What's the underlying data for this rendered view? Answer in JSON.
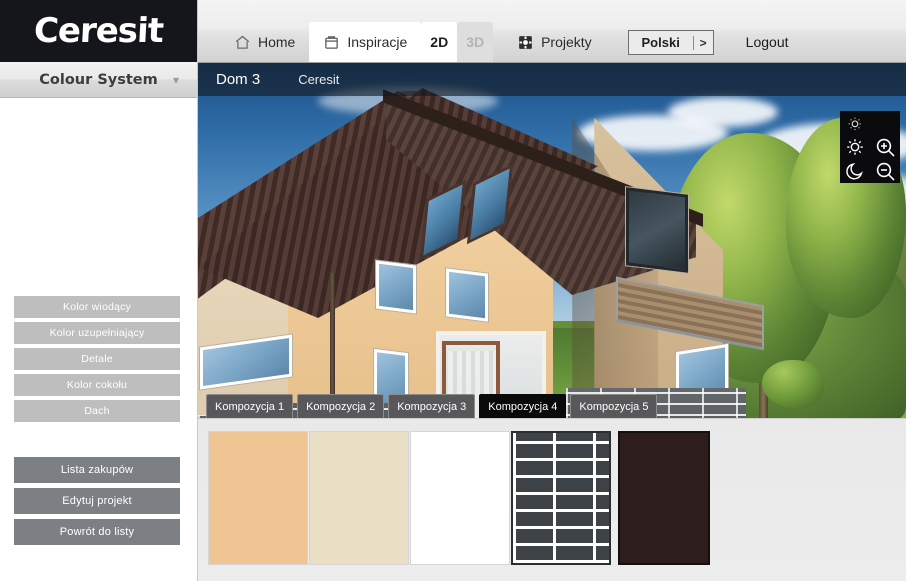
{
  "brand": {
    "name": "Ceresit"
  },
  "sidebar": {
    "header": {
      "title": "Colour System",
      "chevron": "chevron-down"
    },
    "color_buttons": [
      {
        "label": "Kolor wiodący"
      },
      {
        "label": "Kolor uzupełniający"
      },
      {
        "label": "Detale"
      },
      {
        "label": "Kolor cokołu"
      },
      {
        "label": "Dach"
      }
    ],
    "action_buttons": [
      {
        "label": "Lista zakupów"
      },
      {
        "label": "Edytuj projekt"
      },
      {
        "label": "Powrót do listy"
      }
    ],
    "colors": {
      "light_button": "#bebebe",
      "dark_button": "#7c8085"
    }
  },
  "topnav": {
    "items": [
      {
        "label": "Home",
        "icon": "home-icon",
        "active": false
      },
      {
        "label": "Inspiracje",
        "icon": "inspiration-icon",
        "active": true
      },
      {
        "label": "Projekty",
        "icon": "projects-icon",
        "active": false
      }
    ],
    "view_2d": "2D",
    "view_3d": "3D",
    "language": {
      "value": "Polski",
      "arrow": ">"
    },
    "logout": "Logout"
  },
  "viewer": {
    "project_name": "Dom 3",
    "brand_label": "Ceresit",
    "controls": [
      {
        "name": "brightness-high-icon"
      },
      {
        "name": "brightness-low-icon"
      },
      {
        "name": "zoom-in-icon"
      },
      {
        "name": "moon-icon"
      },
      {
        "name": "zoom-out-icon"
      }
    ]
  },
  "compositions": {
    "tabs": [
      {
        "label": "Kompozycja 1",
        "active": false
      },
      {
        "label": "Kompozycja 2",
        "active": false
      },
      {
        "label": "Kompozycja 3",
        "active": false
      },
      {
        "label": "Kompozycja 4",
        "active": true
      },
      {
        "label": "Kompozycja 5",
        "active": false
      }
    ]
  },
  "swatches": [
    {
      "name": "kolor-wiodacy-swatch",
      "color": "#efc693",
      "type": "solid"
    },
    {
      "name": "kolor-uzupelniajacy-swatch",
      "color": "#e8dfc4",
      "type": "solid"
    },
    {
      "name": "detale-swatch",
      "color": "#ffffff",
      "type": "solid"
    },
    {
      "name": "kolor-cokolu-swatch",
      "color": "#3e4347",
      "type": "brick"
    },
    {
      "name": "dach-swatch",
      "color": "#2e1d1d",
      "type": "solid"
    }
  ]
}
